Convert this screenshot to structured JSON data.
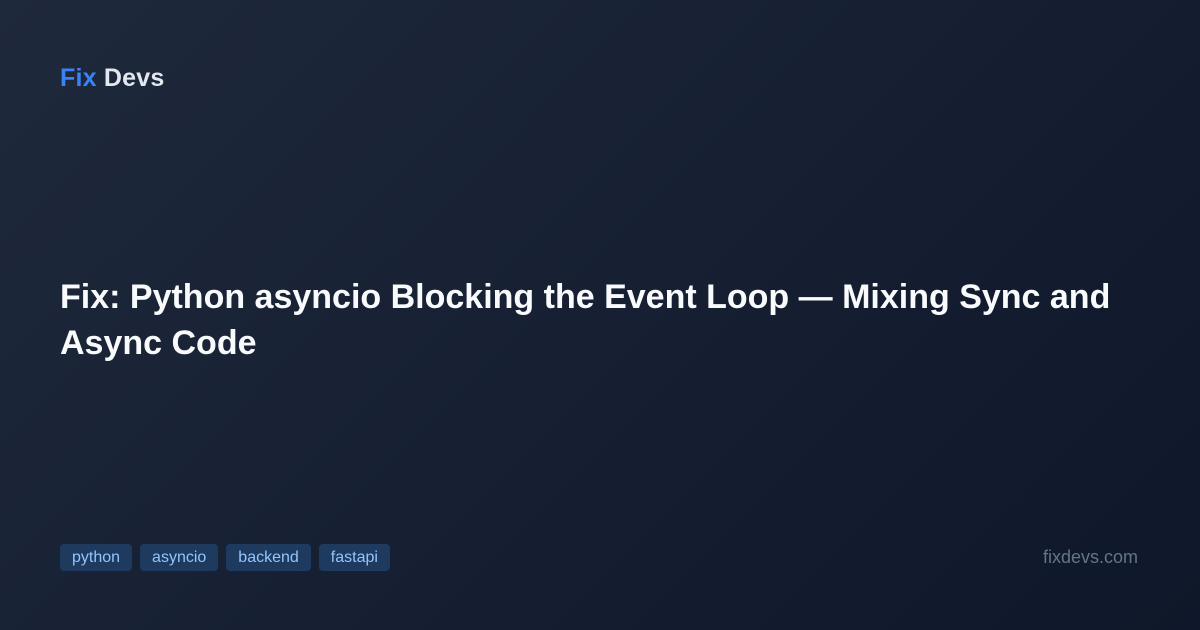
{
  "brand": {
    "prefix": "Fix",
    "name": "Devs"
  },
  "headline": "Fix: Python asyncio Blocking the Event Loop — Mixing Sync and Async Code",
  "tags": [
    "python",
    "asyncio",
    "backend",
    "fastapi"
  ],
  "site": "fixdevs.com",
  "colors": {
    "accent": "#3b82f6",
    "background": "#0f172a",
    "tag_background": "#1e3a5f",
    "tag_text": "#93c5fd"
  }
}
